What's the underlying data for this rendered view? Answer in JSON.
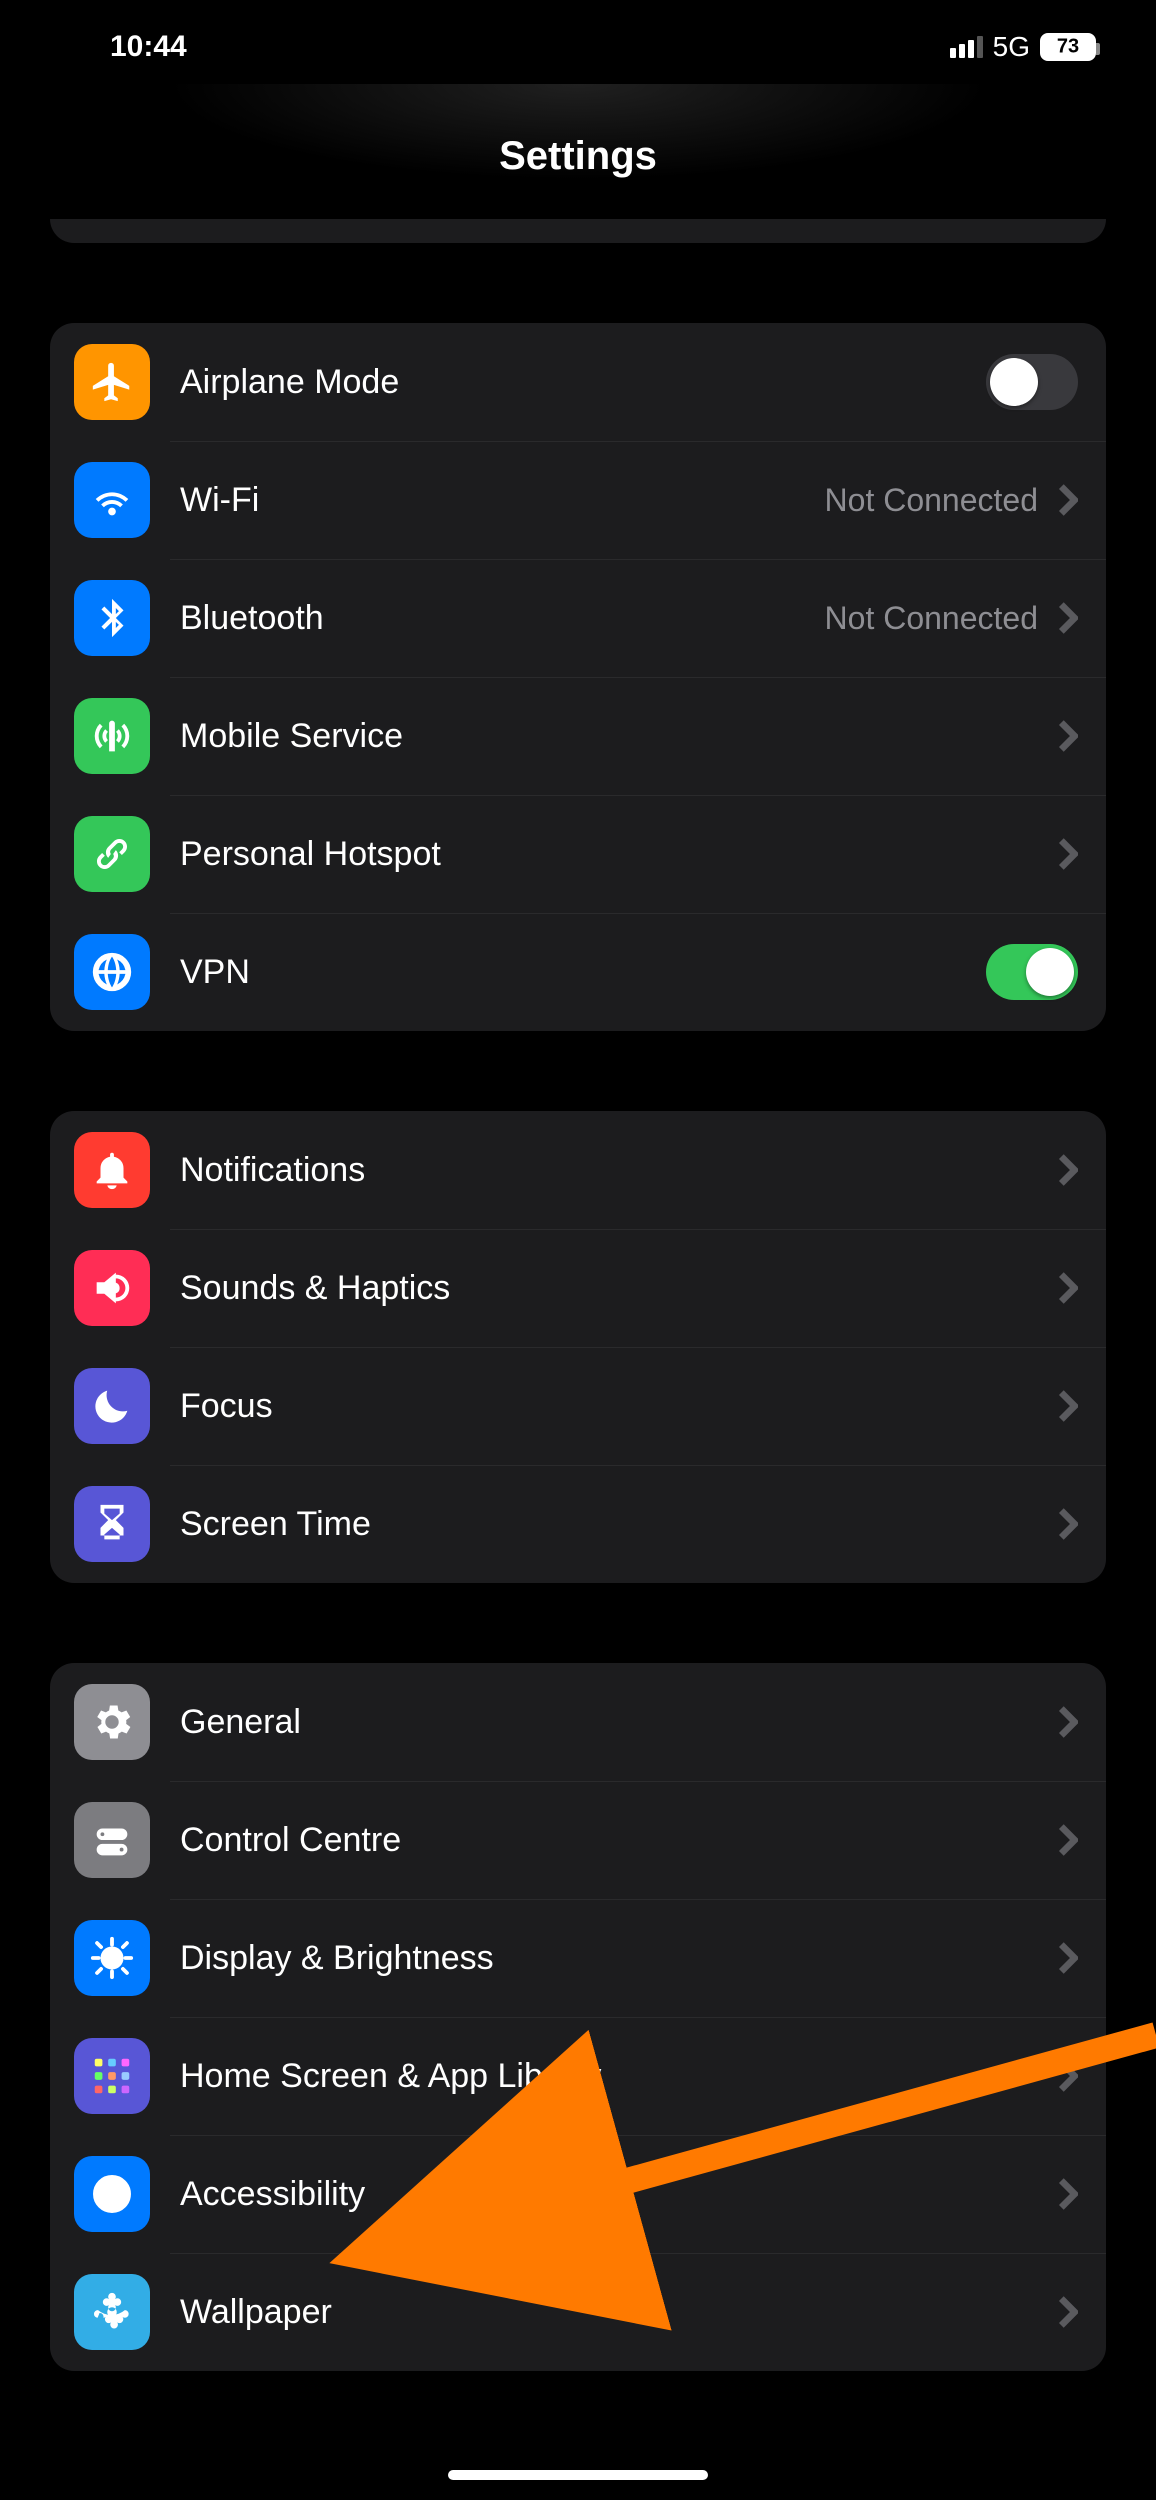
{
  "status_bar": {
    "time": "10:44",
    "network_type": "5G",
    "battery_pct": "73"
  },
  "header": {
    "title": "Settings"
  },
  "groups": [
    {
      "rows": [
        {
          "id": "airplane",
          "icon": "airplane-icon",
          "bg": "bg-orange",
          "label": "Airplane Mode",
          "type": "toggle",
          "value": false
        },
        {
          "id": "wifi",
          "icon": "wifi-icon",
          "bg": "bg-blue",
          "label": "Wi-Fi",
          "type": "nav",
          "value": "Not Connected"
        },
        {
          "id": "bluetooth",
          "icon": "bluetooth-icon",
          "bg": "bg-blue",
          "label": "Bluetooth",
          "type": "nav",
          "value": "Not Connected"
        },
        {
          "id": "mobile",
          "icon": "antenna-icon",
          "bg": "bg-green",
          "label": "Mobile Service",
          "type": "nav",
          "value": ""
        },
        {
          "id": "hotspot",
          "icon": "link-icon",
          "bg": "bg-green",
          "label": "Personal Hotspot",
          "type": "nav",
          "value": ""
        },
        {
          "id": "vpn",
          "icon": "globe-icon",
          "bg": "bg-vpn",
          "label": "VPN",
          "type": "toggle",
          "value": true
        }
      ]
    },
    {
      "rows": [
        {
          "id": "notifications",
          "icon": "bell-icon",
          "bg": "bg-red",
          "label": "Notifications",
          "type": "nav",
          "value": ""
        },
        {
          "id": "sounds",
          "icon": "speaker-icon",
          "bg": "bg-pink",
          "label": "Sounds & Haptics",
          "type": "nav",
          "value": ""
        },
        {
          "id": "focus",
          "icon": "moon-icon",
          "bg": "bg-indigo",
          "label": "Focus",
          "type": "nav",
          "value": ""
        },
        {
          "id": "screentime",
          "icon": "hourglass-icon",
          "bg": "bg-indigo",
          "label": "Screen Time",
          "type": "nav",
          "value": ""
        }
      ]
    },
    {
      "rows": [
        {
          "id": "general",
          "icon": "gear-icon",
          "bg": "bg-gray",
          "label": "General",
          "type": "nav",
          "value": ""
        },
        {
          "id": "controlcentre",
          "icon": "switches-icon",
          "bg": "bg-darkgray",
          "label": "Control Centre",
          "type": "nav",
          "value": ""
        },
        {
          "id": "display",
          "icon": "sun-icon",
          "bg": "bg-display",
          "label": "Display & Brightness",
          "type": "nav",
          "value": ""
        },
        {
          "id": "homescreen",
          "icon": "grid-icon",
          "bg": "bg-purple",
          "label": "Home Screen & App Library",
          "type": "nav",
          "value": ""
        },
        {
          "id": "accessibility",
          "icon": "person-circle-icon",
          "bg": "bg-blue",
          "label": "Accessibility",
          "type": "nav",
          "value": ""
        },
        {
          "id": "wallpaper",
          "icon": "flower-icon",
          "bg": "bg-cyan",
          "label": "Wallpaper",
          "type": "nav",
          "value": ""
        }
      ]
    }
  ],
  "annotation": {
    "target_row_id": "accessibility",
    "color": "#ff7a00"
  }
}
